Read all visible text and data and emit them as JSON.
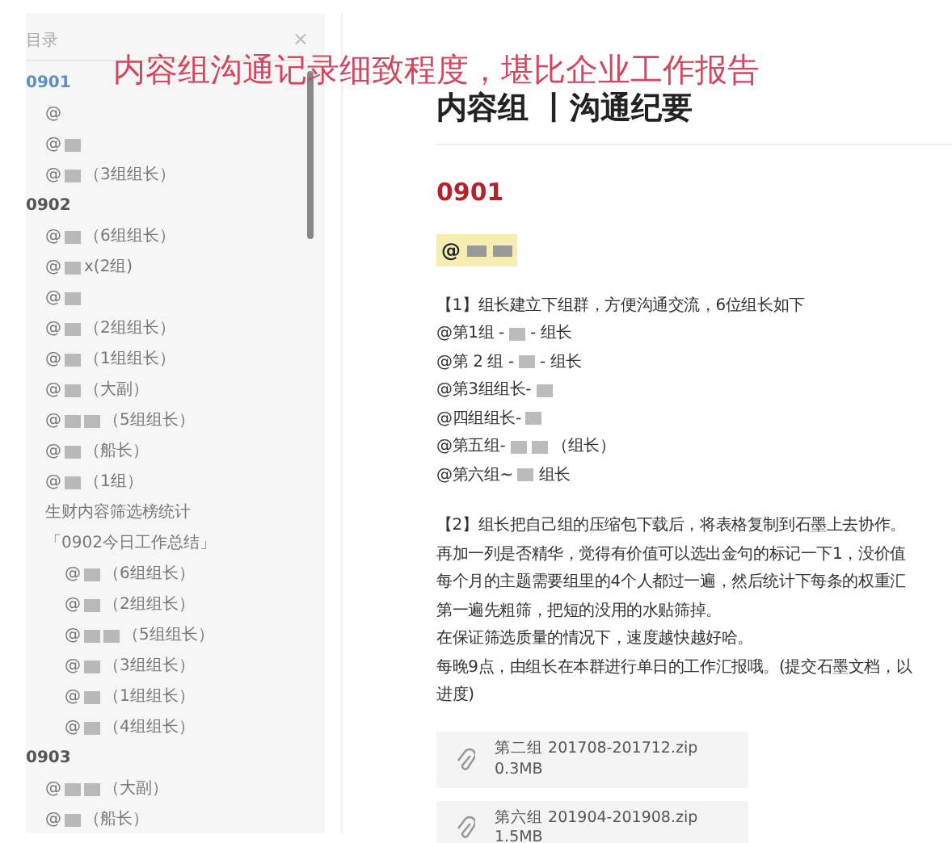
{
  "caption": "内容组沟通记录细致程度，堪比企业工作报告",
  "outline": {
    "title": "目录",
    "close": "×",
    "items": [
      {
        "kind": "heading",
        "selected": true,
        "parts": [
          {
            "kind": "text",
            "text": "0901"
          }
        ],
        "children": [
          {
            "selected": false,
            "parts": [
              {
                "kind": "text",
                "text": "@"
              }
            ]
          },
          {
            "selected": false,
            "parts": [
              {
                "kind": "text",
                "text": "@"
              },
              {
                "kind": "redaction"
              }
            ]
          },
          {
            "selected": false,
            "parts": [
              {
                "kind": "text",
                "text": "@"
              },
              {
                "kind": "redaction"
              },
              {
                "kind": "text",
                "text": "（3组组长）"
              }
            ]
          }
        ]
      },
      {
        "kind": "heading",
        "selected": false,
        "parts": [
          {
            "kind": "text",
            "text": "0902"
          }
        ],
        "children": [
          {
            "selected": false,
            "parts": [
              {
                "kind": "text",
                "text": "@"
              },
              {
                "kind": "redaction"
              },
              {
                "kind": "text",
                "text": "（6组组长）"
              }
            ]
          },
          {
            "selected": false,
            "parts": [
              {
                "kind": "text",
                "text": "@"
              },
              {
                "kind": "redaction"
              },
              {
                "kind": "text",
                "text": "x(2组)"
              }
            ]
          },
          {
            "selected": false,
            "parts": [
              {
                "kind": "text",
                "text": "@"
              },
              {
                "kind": "redaction"
              }
            ]
          },
          {
            "selected": false,
            "parts": [
              {
                "kind": "text",
                "text": "@"
              },
              {
                "kind": "redaction"
              },
              {
                "kind": "text",
                "text": "（2组组长）"
              }
            ]
          },
          {
            "selected": false,
            "parts": [
              {
                "kind": "text",
                "text": "@"
              },
              {
                "kind": "redaction"
              },
              {
                "kind": "text",
                "text": "（1组组长）"
              }
            ]
          },
          {
            "selected": false,
            "parts": [
              {
                "kind": "text",
                "text": "@"
              },
              {
                "kind": "redaction"
              },
              {
                "kind": "text",
                "text": "（大副）"
              }
            ]
          },
          {
            "selected": false,
            "parts": [
              {
                "kind": "text",
                "text": "@"
              },
              {
                "kind": "redaction"
              },
              {
                "kind": "redaction"
              },
              {
                "kind": "text",
                "text": "（5组组长）"
              }
            ]
          },
          {
            "selected": false,
            "parts": [
              {
                "kind": "text",
                "text": "@"
              },
              {
                "kind": "redaction"
              },
              {
                "kind": "text",
                "text": "（船长）"
              }
            ]
          },
          {
            "selected": false,
            "parts": [
              {
                "kind": "text",
                "text": "@"
              },
              {
                "kind": "redaction"
              },
              {
                "kind": "text",
                "text": "（1组）"
              }
            ]
          },
          {
            "selected": false,
            "parts": [
              {
                "kind": "text",
                "text": "生财内容筛选榜统计"
              }
            ]
          },
          {
            "selected": false,
            "parts": [
              {
                "kind": "text",
                "text": "「0902今日工作总结」"
              }
            ],
            "children": [
              {
                "selected": false,
                "parts": [
                  {
                    "kind": "text",
                    "text": "@"
                  },
                  {
                    "kind": "redaction"
                  },
                  {
                    "kind": "text",
                    "text": "（6组组长）"
                  }
                ]
              },
              {
                "selected": false,
                "parts": [
                  {
                    "kind": "text",
                    "text": "@"
                  },
                  {
                    "kind": "redaction"
                  },
                  {
                    "kind": "text",
                    "text": "（2组组长）"
                  }
                ]
              },
              {
                "selected": false,
                "parts": [
                  {
                    "kind": "text",
                    "text": "@"
                  },
                  {
                    "kind": "redaction"
                  },
                  {
                    "kind": "redaction"
                  },
                  {
                    "kind": "text",
                    "text": "（5组组长）"
                  }
                ]
              },
              {
                "selected": false,
                "parts": [
                  {
                    "kind": "text",
                    "text": "@"
                  },
                  {
                    "kind": "redaction"
                  },
                  {
                    "kind": "text",
                    "text": "（3组组长）"
                  }
                ]
              },
              {
                "selected": false,
                "parts": [
                  {
                    "kind": "text",
                    "text": "@"
                  },
                  {
                    "kind": "redaction"
                  },
                  {
                    "kind": "text",
                    "text": "（1组组长）"
                  }
                ]
              },
              {
                "selected": false,
                "parts": [
                  {
                    "kind": "text",
                    "text": "@"
                  },
                  {
                    "kind": "redaction"
                  },
                  {
                    "kind": "text",
                    "text": "（4组组长）"
                  }
                ]
              }
            ]
          }
        ]
      },
      {
        "kind": "heading",
        "selected": false,
        "parts": [
          {
            "kind": "text",
            "text": "0903"
          }
        ],
        "children": [
          {
            "selected": false,
            "parts": [
              {
                "kind": "text",
                "text": "@"
              },
              {
                "kind": "redaction"
              },
              {
                "kind": "redaction"
              },
              {
                "kind": "text",
                "text": "（大副）"
              }
            ]
          },
          {
            "selected": false,
            "parts": [
              {
                "kind": "text",
                "text": "@"
              },
              {
                "kind": "redaction"
              },
              {
                "kind": "text",
                "text": "（船长）"
              }
            ]
          }
        ]
      }
    ]
  },
  "document": {
    "title": "内容组 丨沟通纪要",
    "section": "0901",
    "mention": [
      {
        "kind": "text",
        "text": "@"
      },
      {
        "kind": "redaction"
      },
      {
        "kind": "redaction"
      }
    ],
    "paragraphs": [
      [
        [
          {
            "kind": "text",
            "text": "【1】组长建立下组群，方便沟通交流，6位组长如下"
          }
        ],
        [
          {
            "kind": "text",
            "text": "@第1组 -"
          },
          {
            "kind": "redaction"
          },
          {
            "kind": "text",
            "text": "- 组长"
          }
        ],
        [
          {
            "kind": "text",
            "text": "@第 2 组 -"
          },
          {
            "kind": "redaction"
          },
          {
            "kind": "text",
            "text": "- 组长"
          }
        ],
        [
          {
            "kind": "text",
            "text": "@第3组组长-"
          },
          {
            "kind": "redaction"
          }
        ],
        [
          {
            "kind": "text",
            "text": "@四组组长-"
          },
          {
            "kind": "redaction"
          }
        ],
        [
          {
            "kind": "text",
            "text": "@第五组-"
          },
          {
            "kind": "redaction"
          },
          {
            "kind": "redaction"
          },
          {
            "kind": "text",
            "text": "（组长）"
          }
        ],
        [
          {
            "kind": "text",
            "text": "@第六组~"
          },
          {
            "kind": "redaction"
          },
          {
            "kind": "text",
            "text": "组长"
          }
        ]
      ],
      [
        [
          {
            "kind": "text",
            "text": "【2】组长把自己组的压缩包下载后，将表格复制到石墨上去协作。"
          }
        ],
        [
          {
            "kind": "text",
            "text": "再加一列是否精华，觉得有价值可以选出金句的标记一下1，没价值"
          }
        ],
        [
          {
            "kind": "text",
            "text": "每个月的主题需要组里的4个人都过一遍，然后统计下每条的权重汇"
          }
        ],
        [
          {
            "kind": "text",
            "text": "第一遍先粗筛，把短的没用的水贴筛掉。"
          }
        ],
        [
          {
            "kind": "text",
            "text": "在保证筛选质量的情况下，速度越快越好哈。"
          }
        ],
        [
          {
            "kind": "text",
            "text": "每晚9点，由组长在本群进行单日的工作汇报哦。(提交石墨文档，以"
          }
        ],
        [
          {
            "kind": "text",
            "text": "进度)"
          }
        ]
      ]
    ],
    "attachments": [
      {
        "name": "第二组 201708-201712.zip",
        "size": "0.3MB"
      },
      {
        "name": "第六组 201904-201908.zip",
        "size": "1.5MB"
      }
    ]
  }
}
